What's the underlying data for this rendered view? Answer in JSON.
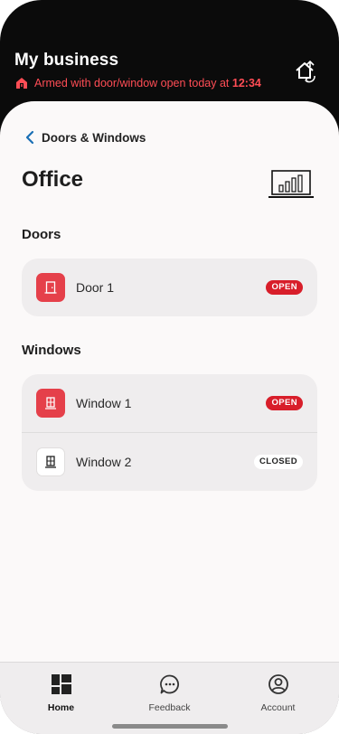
{
  "header": {
    "title": "My business",
    "status_prefix": "Armed with door/window open today at ",
    "status_time": "12:34",
    "status_color": "#ff4d55"
  },
  "nav": {
    "back_label": "Doors & Windows"
  },
  "page": {
    "title": "Office",
    "icon": "laptop-chart-icon"
  },
  "doors": {
    "section_title": "Doors",
    "items": [
      {
        "label": "Door 1",
        "state": "OPEN",
        "icon": "door-icon"
      }
    ]
  },
  "windows": {
    "section_title": "Windows",
    "items": [
      {
        "label": "Window 1",
        "state": "OPEN",
        "icon": "window-icon"
      },
      {
        "label": "Window 2",
        "state": "CLOSED",
        "icon": "window-icon"
      }
    ]
  },
  "tabs": [
    {
      "label": "Home",
      "icon": "home-grid-icon",
      "active": true
    },
    {
      "label": "Feedback",
      "icon": "feedback-icon",
      "active": false
    },
    {
      "label": "Account",
      "icon": "account-icon",
      "active": false
    }
  ],
  "colors": {
    "accent_red": "#d81e2a",
    "tile_red": "#e5404a",
    "header_bg": "#0b0b0b"
  }
}
